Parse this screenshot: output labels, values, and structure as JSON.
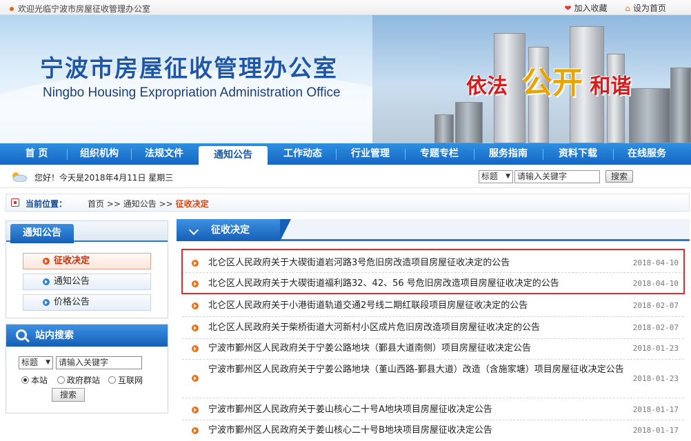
{
  "top": {
    "welcome": "欢迎光临宁波市房屋征收管理办公室",
    "favorite": "加入收藏",
    "homepage": "设为首页"
  },
  "banner": {
    "title_cn": "宁波市房屋征收管理办公室",
    "title_en": "Ningbo Housing Expropriation Administration Office",
    "slogan": [
      "依法",
      "公开",
      "和谐"
    ]
  },
  "nav": [
    "首 页",
    "组织机构",
    "法规文件",
    "通知公告",
    "工作动态",
    "行业管理",
    "专题专栏",
    "服务指南",
    "资料下载",
    "在线服务"
  ],
  "greeting": {
    "text": "您好！今天是2018年4月11日 星期三",
    "select": "标题",
    "keyword_placeholder": "请输入关键字",
    "search": "搜索"
  },
  "breadcrumb": {
    "label": "当前位置：",
    "home": "首页",
    "section": "通知公告",
    "current": "征收决定",
    "sep": ">>"
  },
  "sidebar": {
    "title": "通知公告",
    "items": [
      "征收决定",
      "通知公告",
      "价格公告"
    ]
  },
  "site_search": {
    "title": "站内搜索",
    "select": "标题",
    "keyword_placeholder": "请输入关键字",
    "options": [
      "本站",
      "政府群站",
      "互联网"
    ],
    "button": "搜索"
  },
  "list": {
    "title": "征收决定",
    "rows": [
      {
        "title": "北仑区人民政府关于大碶街道岩河路3号危旧房改造项目房屋征收决定的公告",
        "date": "2018-04-10"
      },
      {
        "title": "北仑区人民政府关于大碶街道福利路32、42、56 号危旧房改造项目房屋征收决定的公告",
        "date": "2018-04-10"
      },
      {
        "title": "北仑区人民政府关于小港街道轨道交通2号线二期红联段项目房屋征收决定的公告",
        "date": "2018-02-07"
      },
      {
        "title": "北仑区人民政府关于柴桥街道大河新村小区成片危旧房改造项目房屋征收决定的公告",
        "date": "2018-02-07"
      },
      {
        "title": "宁波市鄞州区人民政府关于宁姜公路地块（鄞县大道南侧）项目房屋征收决定公告",
        "date": "2018-01-23"
      },
      {
        "title": "宁波市鄞州区人民政府关于宁姜公路地块（堇山西路-鄞县大道）改造（含施家塘）项目房屋征收决定公告",
        "date": "2018-01-23"
      },
      {
        "title": "宁波市鄞州区人民政府关于姜山核心二十号A地块项目房屋征收决定公告",
        "date": "2018-01-17"
      },
      {
        "title": "宁波市鄞州区人民政府关于姜山核心二十号B地块项目房屋征收决定公告",
        "date": "2018-01-17"
      }
    ]
  }
}
